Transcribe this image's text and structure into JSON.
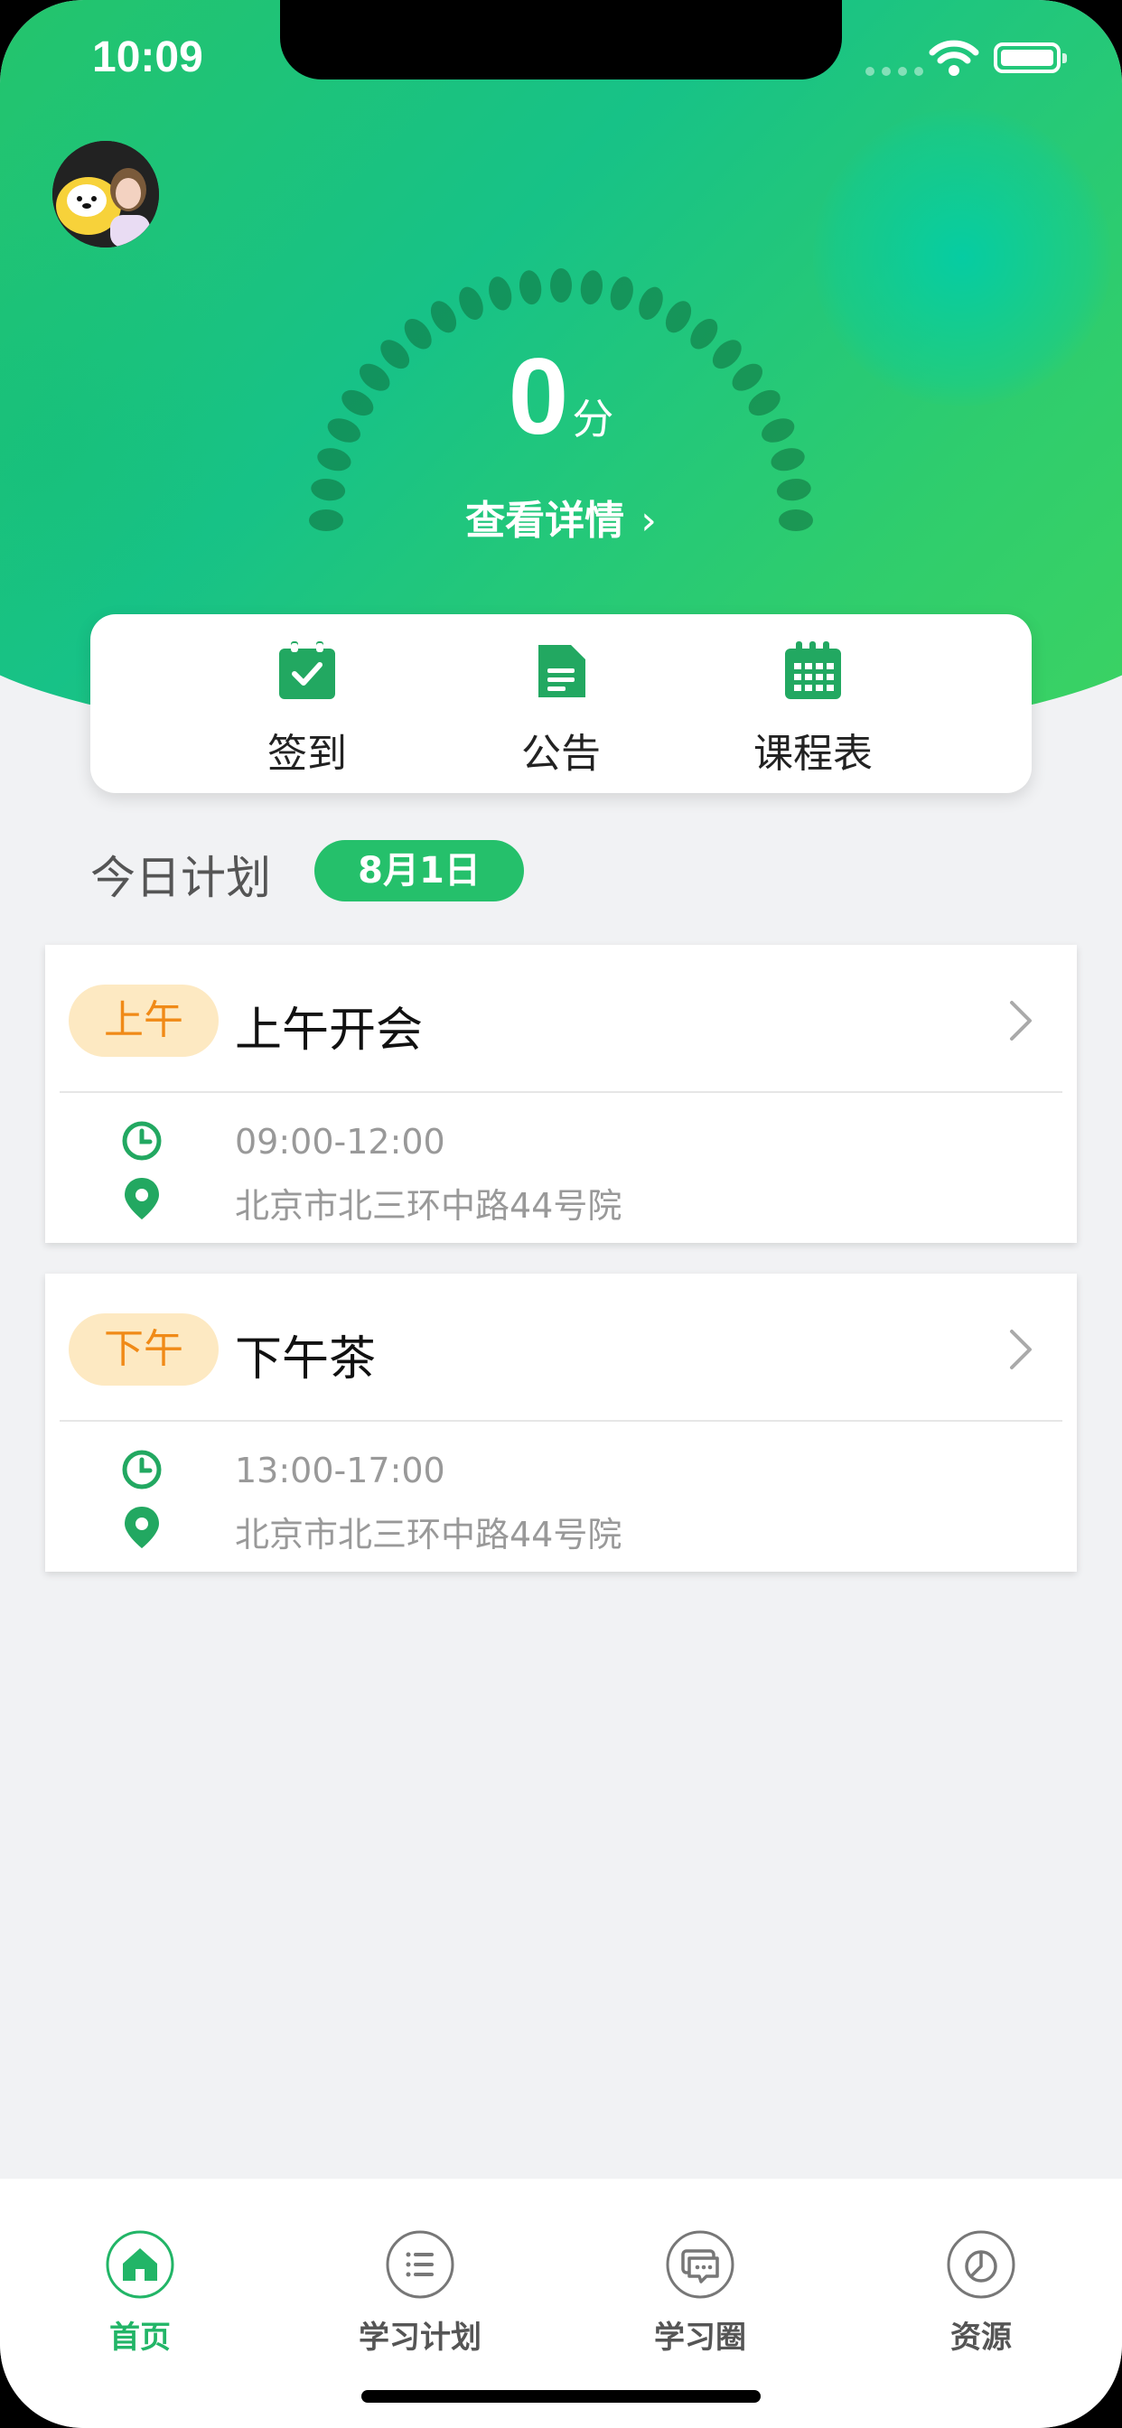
{
  "status_bar": {
    "time": "10:09"
  },
  "header": {
    "score_value": "0",
    "score_unit": "分",
    "detail_link": "查看详情",
    "detail_chevron": "›"
  },
  "quick_actions": [
    {
      "label": "签到",
      "icon": "calendar-check-icon"
    },
    {
      "label": "公告",
      "icon": "document-icon"
    },
    {
      "label": "课程表",
      "icon": "calendar-grid-icon"
    }
  ],
  "plan": {
    "title": "今日计划",
    "date": "8月1日",
    "items": [
      {
        "badge": "上午",
        "title": "上午开会",
        "time": "09:00-12:00",
        "address": "北京市北三环中路44号院"
      },
      {
        "badge": "下午",
        "title": "下午茶",
        "time": "13:00-17:00",
        "address": "北京市北三环中路44号院"
      }
    ]
  },
  "tabs": [
    {
      "label": "首页",
      "icon": "home-icon",
      "active": true
    },
    {
      "label": "学习计划",
      "icon": "list-icon",
      "active": false
    },
    {
      "label": "学习圈",
      "icon": "chat-icon",
      "active": false
    },
    {
      "label": "资源",
      "icon": "pie-chart-icon",
      "active": false
    }
  ],
  "colors": {
    "brand_green": "#25c06b",
    "badge_bg": "#fde9c2",
    "badge_text": "#f08a17"
  }
}
